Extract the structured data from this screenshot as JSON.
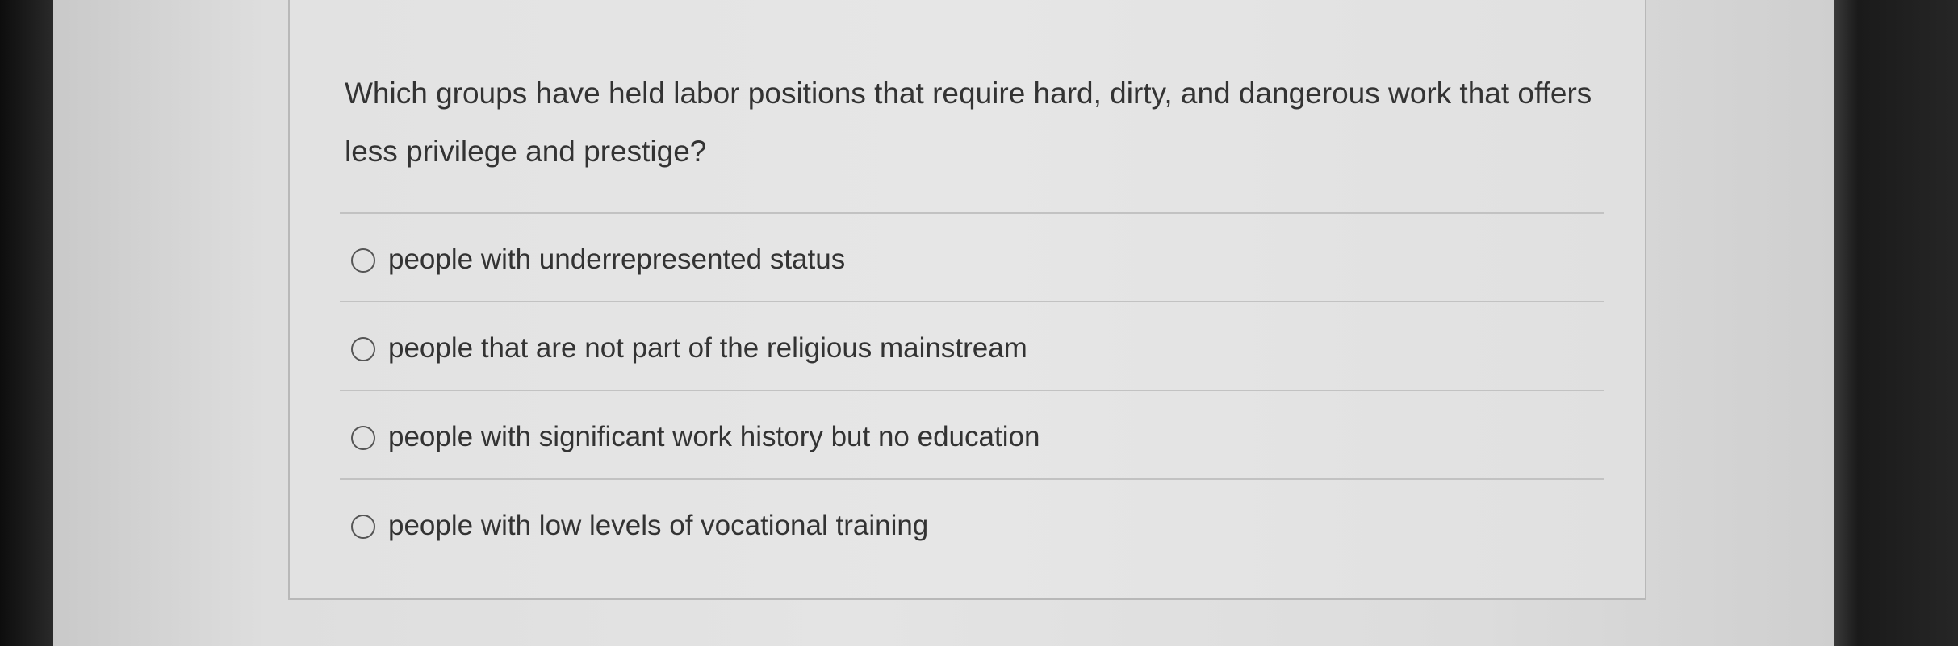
{
  "question": {
    "text": "Which groups have held labor positions that require hard, dirty, and dangerous work that offers less privilege and prestige?"
  },
  "answers": [
    {
      "label": "people with underrepresented status",
      "selected": false
    },
    {
      "label": "people that are not part of the religious mainstream",
      "selected": false
    },
    {
      "label": "people with significant work history but no education",
      "selected": false
    },
    {
      "label": "people with low levels of vocational training",
      "selected": false
    }
  ]
}
